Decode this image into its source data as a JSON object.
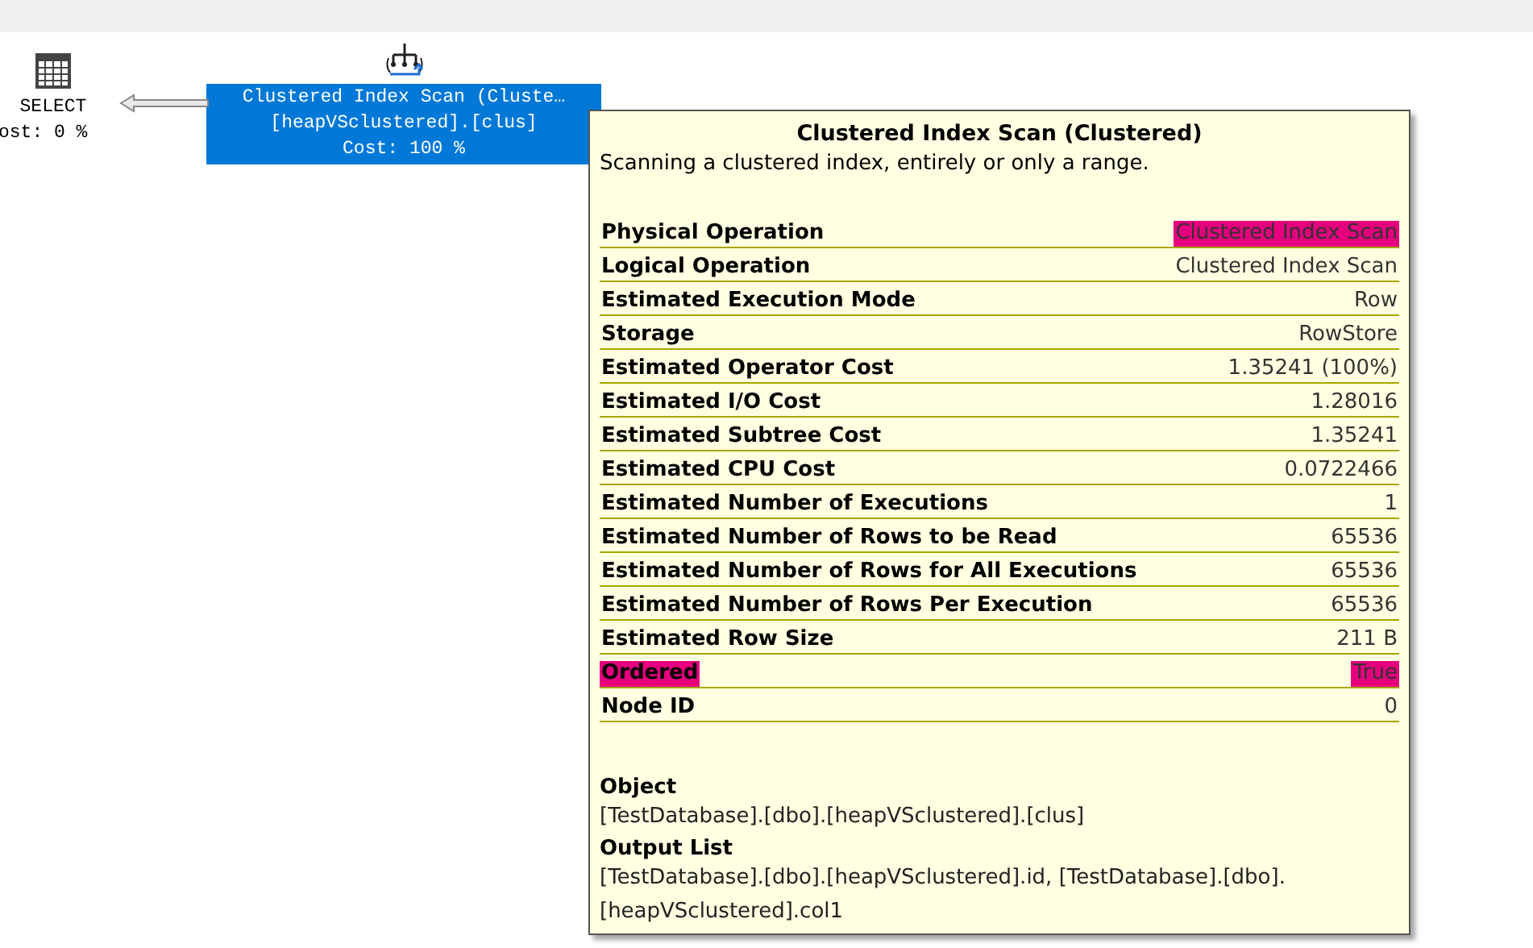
{
  "plan": {
    "nodes": [
      {
        "kind": "select",
        "lines": [
          "SELECT",
          "ost: 0 %"
        ],
        "selected": false
      },
      {
        "kind": "scan",
        "lines": [
          "Clustered Index Scan (Cluste…",
          "[heapVSclustered].[clus]",
          "Cost: 100 %"
        ],
        "selected": true
      }
    ]
  },
  "tooltip": {
    "title": "Clustered Index Scan (Clustered)",
    "description": "Scanning a clustered index, entirely or only a range.",
    "properties": [
      {
        "label": "Physical Operation",
        "value": "Clustered Index Scan",
        "label_marked": false,
        "value_marked": true
      },
      {
        "label": "Logical Operation",
        "value": "Clustered Index Scan",
        "label_marked": false,
        "value_marked": false
      },
      {
        "label": "Estimated Execution Mode",
        "value": "Row",
        "label_marked": false,
        "value_marked": false
      },
      {
        "label": "Storage",
        "value": "RowStore",
        "label_marked": false,
        "value_marked": false
      },
      {
        "label": "Estimated Operator Cost",
        "value": "1.35241 (100%)",
        "label_marked": false,
        "value_marked": false
      },
      {
        "label": "Estimated I/O Cost",
        "value": "1.28016",
        "label_marked": false,
        "value_marked": false
      },
      {
        "label": "Estimated Subtree Cost",
        "value": "1.35241",
        "label_marked": false,
        "value_marked": false
      },
      {
        "label": "Estimated CPU Cost",
        "value": "0.0722466",
        "label_marked": false,
        "value_marked": false
      },
      {
        "label": "Estimated Number of Executions",
        "value": "1",
        "label_marked": false,
        "value_marked": false
      },
      {
        "label": "Estimated Number of Rows to be Read",
        "value": "65536",
        "label_marked": false,
        "value_marked": false
      },
      {
        "label": "Estimated Number of Rows for All Executions",
        "value": "65536",
        "label_marked": false,
        "value_marked": false
      },
      {
        "label": "Estimated Number of Rows Per Execution",
        "value": "65536",
        "label_marked": false,
        "value_marked": false
      },
      {
        "label": "Estimated Row Size",
        "value": "211 B",
        "label_marked": false,
        "value_marked": false
      },
      {
        "label": "Ordered",
        "value": "True",
        "label_marked": true,
        "value_marked": true
      },
      {
        "label": "Node ID",
        "value": "0",
        "label_marked": false,
        "value_marked": false
      }
    ],
    "sections": [
      {
        "heading": "Object",
        "text": "[TestDatabase].[dbo].[heapVSclustered].[clus]"
      },
      {
        "heading": "Output List",
        "text": "[TestDatabase].[dbo].[heapVSclustered].id, [TestDatabase].[dbo].[heapVSclustered].col1"
      }
    ]
  }
}
